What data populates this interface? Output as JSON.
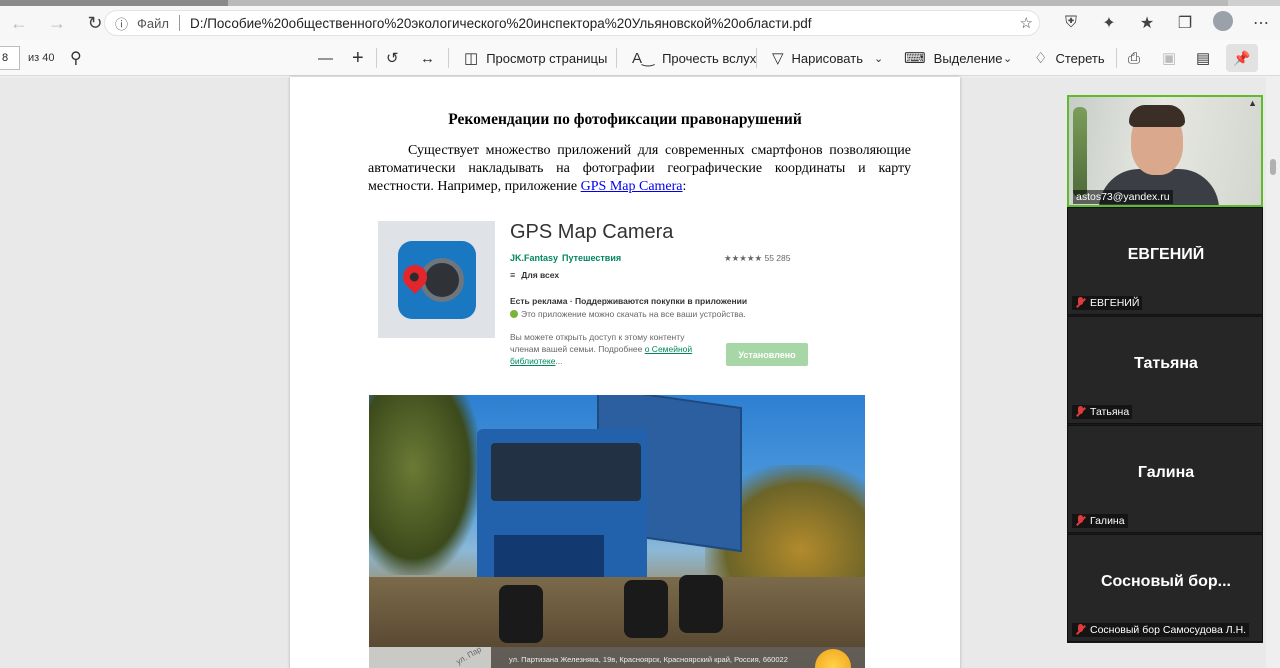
{
  "browser": {
    "url_prefix": "Файл",
    "url": "D:/Пособие%20общественного%20экологического%20инспектора%20Ульяновской%20области.pdf"
  },
  "pdf_toolbar": {
    "page_number": "8",
    "page_total": "из 40",
    "page_view": "Просмотр страницы",
    "read_aloud": "Прочесть вслух",
    "draw": "Нарисовать",
    "highlight": "Выделение",
    "erase": "Стереть"
  },
  "document": {
    "title": "Рекомендации по фотофиксации правонарушений",
    "paragraph": "Существует множество приложений для современных смартфонов позволяющие автоматически накладывать на фотографии географические координаты и карту местности. Например, приложение ",
    "link": "GPS Map Camera",
    "paragraph_end": ":"
  },
  "app_card": {
    "name": "GPS Map Camera",
    "developer": "JK.Fantasy",
    "category": "Путешествия",
    "rating": "★★★★★ 55 285",
    "age": "Для всех",
    "ads": "Есть реклама · Поддерживаются покупки в приложении",
    "devices": "Это приложение можно скачать на все ваши устройства.",
    "family_text": "Вы можете открыть доступ к этому контенту членам вашей семьи. Подробнее ",
    "family_link": "о Семейной библиотеке",
    "family_end": "...",
    "install": "Установлено"
  },
  "photo": {
    "street": "ул. Пар",
    "address": "ул. Партизана Железняка, 19в, Красноярск, Красноярский край, Россия, 660022"
  },
  "call": {
    "self_email": "astos73@yandex.ru",
    "participants": [
      {
        "big": "ЕВГЕНИЙ",
        "small": "ЕВГЕНИЙ"
      },
      {
        "big": "Татьяна",
        "small": "Татьяна"
      },
      {
        "big": "Галина",
        "small": "Галина"
      },
      {
        "big": "Сосновый бор...",
        "small": "Сосновый бор Самосудова Л.Н."
      }
    ]
  }
}
